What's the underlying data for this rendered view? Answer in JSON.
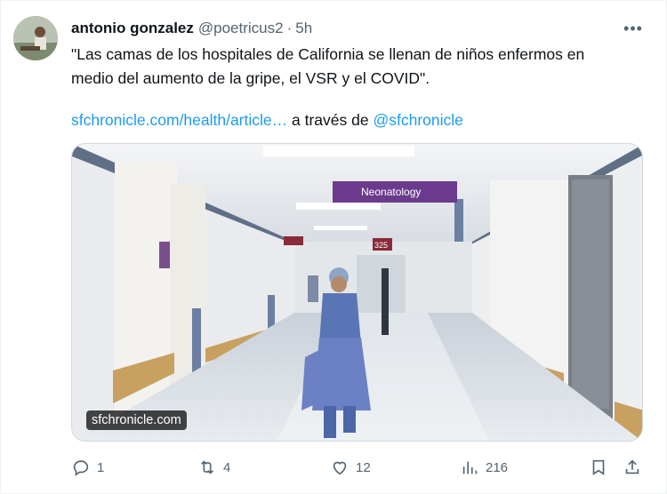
{
  "author": {
    "display_name": "antonio gonzalez",
    "handle": "@poetricus2",
    "separator": "·",
    "time": "5h"
  },
  "tweet": {
    "text_line1": "\"Las camas de los hospitales de California se llenan de niños enfermos en",
    "text_line2": "medio del aumento de la gripe, el VSR y el COVID\".",
    "link_url": "sfchronicle.com/health/article…",
    "via_text": " a través de ",
    "mention": "@sfchronicle"
  },
  "media": {
    "sign_text": "Neonatology",
    "room_number": "325",
    "caption": "sfchronicle.com"
  },
  "actions": {
    "reply_count": "1",
    "retweet_count": "4",
    "like_count": "12",
    "views_count": "216"
  },
  "icons": {
    "more": "more-options-icon",
    "reply": "reply-icon",
    "retweet": "retweet-icon",
    "like": "heart-icon",
    "views": "views-chart-icon",
    "bookmark": "bookmark-icon",
    "share": "share-icon"
  },
  "colors": {
    "link": "#1d9bf0",
    "secondary_text": "#536471",
    "sign_background": "#6b3a8c"
  }
}
